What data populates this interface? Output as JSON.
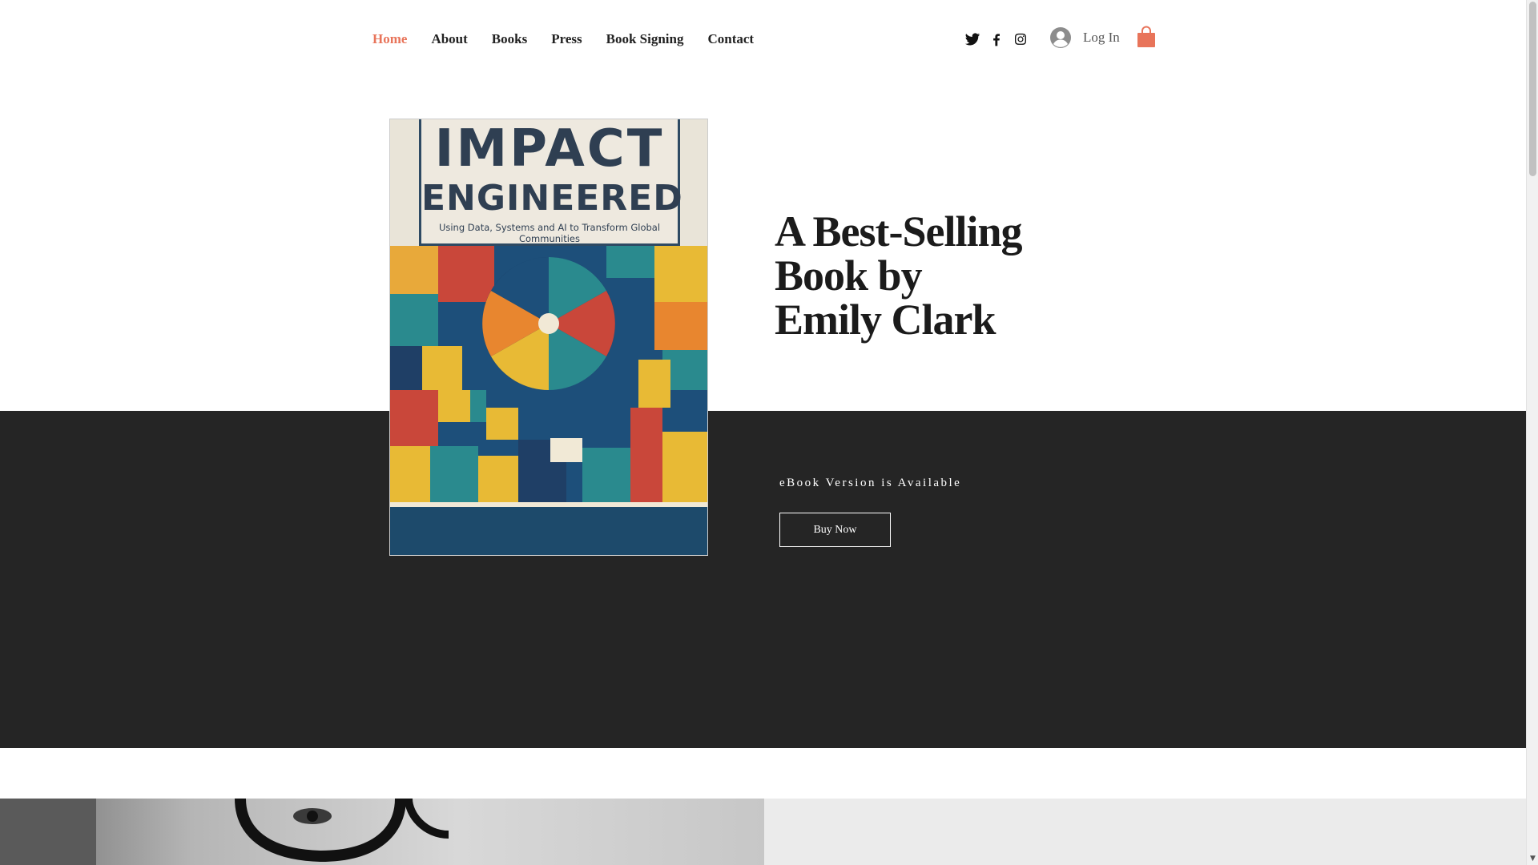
{
  "nav": {
    "items": [
      {
        "label": "Home",
        "active": true
      },
      {
        "label": "About",
        "active": false
      },
      {
        "label": "Books",
        "active": false
      },
      {
        "label": "Press",
        "active": false
      },
      {
        "label": "Book Signing",
        "active": false
      },
      {
        "label": "Contact",
        "active": false
      }
    ],
    "active_color": "#e8745a"
  },
  "social": [
    "twitter-icon",
    "facebook-icon",
    "instagram-icon"
  ],
  "login": {
    "label": "Log In",
    "icon": "user-avatar-icon"
  },
  "cart": {
    "icon": "shopping-bag-icon"
  },
  "book_cover": {
    "title_line1": "IMPACT",
    "title_line2": "ENGINEERED",
    "subtitle": "Using Data, Systems and AI to Transform Global Communities"
  },
  "hero": {
    "title_lines": [
      "A Best-Selling",
      "Book by",
      "Emily Clark"
    ],
    "ebook_text": "eBook Version is Available",
    "buy_label": "Buy Now"
  },
  "colors": {
    "band": "#252525",
    "gray_panel": "#ebebeb"
  }
}
